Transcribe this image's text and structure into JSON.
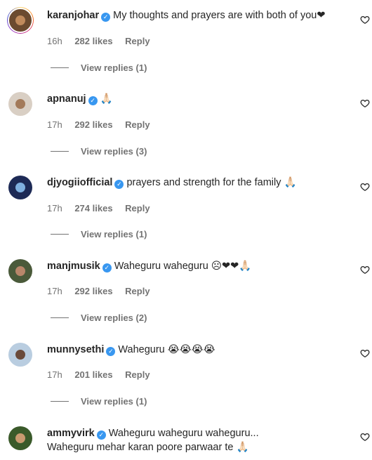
{
  "comments": [
    {
      "username": "karanjohar",
      "text": "My thoughts and prayers are with both of you❤",
      "time": "16h",
      "likes": "282 likes",
      "reply": "Reply",
      "view_replies": "View replies (1)"
    },
    {
      "username": "apnanuj",
      "text": "🙏🏻",
      "time": "17h",
      "likes": "292 likes",
      "reply": "Reply",
      "view_replies": "View replies (3)"
    },
    {
      "username": "djyogiiofficial",
      "text": "prayers and strength for the family 🙏🏻",
      "time": "17h",
      "likes": "274 likes",
      "reply": "Reply",
      "view_replies": "View replies (1)"
    },
    {
      "username": "manjmusik",
      "text": "Waheguru waheguru ☹❤❤🙏🏻",
      "time": "17h",
      "likes": "292 likes",
      "reply": "Reply",
      "view_replies": "View replies (2)"
    },
    {
      "username": "munnysethi",
      "text": "Waheguru 😭😭😭😭",
      "time": "17h",
      "likes": "201 likes",
      "reply": "Reply",
      "view_replies": "View replies (1)"
    },
    {
      "username": "ammyvirk",
      "text": "Waheguru waheguru waheguru...",
      "text2": "Waheguru mehar karan poore parwaar te 🙏🏻"
    }
  ],
  "icons": {
    "verified": "verified-badge-icon",
    "like": "heart-outline-icon"
  },
  "colors": {
    "verified": "#3897f0",
    "muted": "#737373",
    "text": "#262626"
  }
}
